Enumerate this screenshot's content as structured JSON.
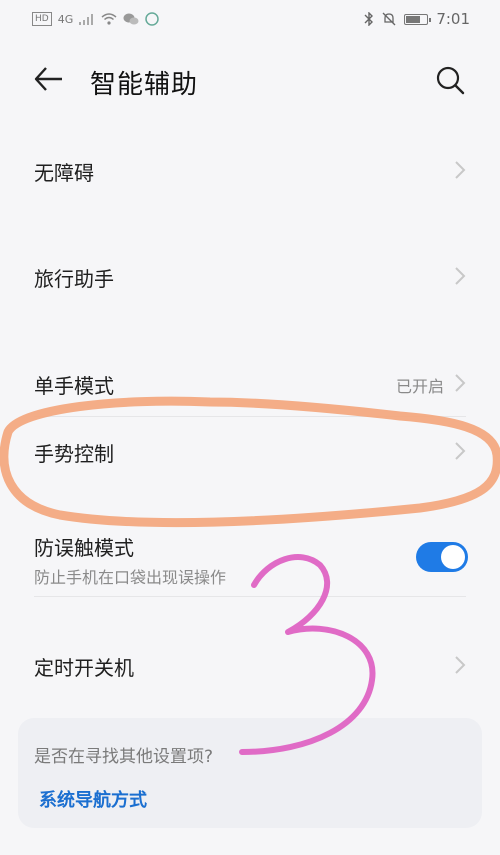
{
  "status_bar": {
    "network": "4G",
    "time": "7:01",
    "hd_label": "HD"
  },
  "header": {
    "title": "智能辅助"
  },
  "items": [
    {
      "label": "无障碍"
    },
    {
      "label": "旅行助手"
    },
    {
      "label": "单手模式",
      "value": "已开启"
    },
    {
      "label": "手势控制"
    },
    {
      "label": "防误触模式",
      "subtitle": "防止手机在口袋出现误操作",
      "toggle_on": true
    },
    {
      "label": "定时开关机"
    }
  ],
  "suggestion_card": {
    "question": "是否在寻找其他设置项?",
    "link": "系统导航方式"
  },
  "colors": {
    "accent": "#1f7be6",
    "link": "#1b6fd0",
    "highlight_orange": "#f4a57a",
    "annotation_pink": "#e06bc6"
  }
}
